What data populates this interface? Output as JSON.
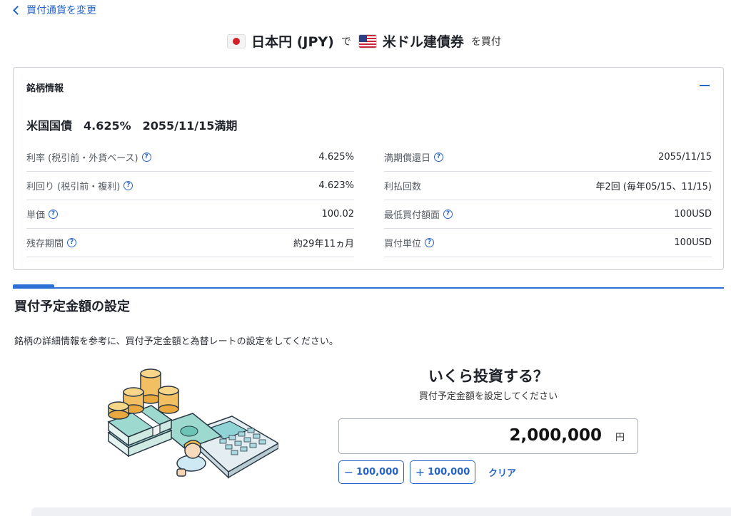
{
  "nav": {
    "back_label": "買付通貨を変更"
  },
  "header": {
    "from_currency": "日本円 (JPY)",
    "connector": "で",
    "product": "米ドル建債券",
    "suffix": "を買付",
    "from_flag_icon": "japan-flag-icon",
    "to_flag_icon": "us-flag-icon"
  },
  "bond_info": {
    "section_label": "銘柄情報",
    "bond_name": "米国国債　4.625%　2055/11/15満期",
    "left_rows": [
      {
        "label": "利率 (税引前・外貨ベース)",
        "value": "4.625%",
        "help": true
      },
      {
        "label": "利回り (税引前・複利)",
        "value": "4.623%",
        "help": true
      },
      {
        "label": "単価",
        "value": "100.02",
        "help": true
      },
      {
        "label": "残存期間",
        "value": "約29年11ヵ月",
        "help": true
      }
    ],
    "right_rows": [
      {
        "label": "満期償還日",
        "value": "2055/11/15",
        "help": true
      },
      {
        "label": "利払回数",
        "value": "年2回 (毎年05/15、11/15)",
        "help": false
      },
      {
        "label": "最低買付額面",
        "value": "100USD",
        "help": true
      },
      {
        "label": "買付単位",
        "value": "100USD",
        "help": true
      }
    ]
  },
  "amount_section": {
    "title": "買付予定金額の設定",
    "description": "銘柄の詳細情報を参考に、買付予定金額と為替レートの設定をしてください。",
    "question": "いくら投資する？",
    "question_sub": "買付予定金額を設定してください",
    "amount_value": "2,000,000",
    "amount_unit": "円",
    "minus_label": "100,000",
    "plus_label": "100,000",
    "clear_label": "クリア"
  },
  "colors": {
    "accent": "#2563c7",
    "divider": "#2c6fd6",
    "border": "#c9ced6"
  }
}
